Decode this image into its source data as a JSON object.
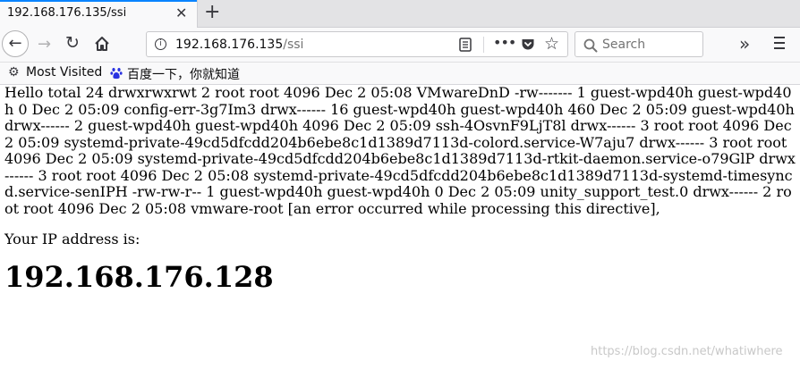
{
  "tab": {
    "title": "192.168.176.135/ssi",
    "close_glyph": "✕",
    "new_tab_glyph": "+"
  },
  "nav": {
    "back_glyph": "←",
    "forward_glyph": "→",
    "reload_glyph": "↻"
  },
  "url": {
    "host": "192.168.176.135",
    "path": "/ssi"
  },
  "search": {
    "placeholder": "Search"
  },
  "icons": [
    "back-icon",
    "forward-icon",
    "reload-icon",
    "home-icon",
    "info-icon",
    "reader-view-icon",
    "page-actions-icon",
    "pocket-icon",
    "bookmark-star-icon",
    "search-icon",
    "overflow-icon",
    "hamburger-menu-icon",
    "gear-icon",
    "baidu-paw-icon"
  ],
  "bookmarks": {
    "most_visited": "Most Visited",
    "baidu": "百度一下，你就知道"
  },
  "content": {
    "dir_output": "Hello total 24 drwxrwxrwt 2 root root 4096 Dec 2 05:08 VMwareDnD -rw------- 1 guest-wpd40h guest-wpd40h 0 Dec 2 05:09 config-err-3g7Im3 drwx------ 16 guest-wpd40h guest-wpd40h 460 Dec 2 05:09 guest-wpd40h drwx------ 2 guest-wpd40h guest-wpd40h 4096 Dec 2 05:09 ssh-4OsvnF9LjT8l drwx------ 3 root root 4096 Dec 2 05:09 systemd-private-49cd5dfcdd204b6ebe8c1d1389d7113d-colord.service-W7aju7 drwx------ 3 root root 4096 Dec 2 05:09 systemd-private-49cd5dfcdd204b6ebe8c1d1389d7113d-rtkit-daemon.service-o79GlP drwx------ 3 root root 4096 Dec 2 05:08 systemd-private-49cd5dfcdd204b6ebe8c1d1389d7113d-systemd-timesyncd.service-senIPH -rw-rw-r-- 1 guest-wpd40h guest-wpd40h 0 Dec 2 05:09 unity_support_test.0 drwx------ 2 root root 4096 Dec 2 05:08 vmware-root [an error occurred while processing this directive],",
    "ip_label": "Your IP address is:",
    "ip_value": "192.168.176.128"
  },
  "watermark": "https://blog.csdn.net/whatiwhere"
}
